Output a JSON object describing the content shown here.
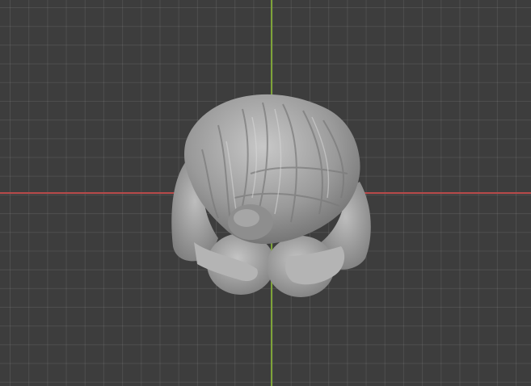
{
  "viewport": {
    "background_color": "#3d3d3d",
    "grid_color": "#4a4a4a",
    "axis_x_color": "#b84a4a",
    "axis_y_color": "#7ea338"
  },
  "model": {
    "icon": "sculpt-mesh-icon",
    "color": "#a8a8a8"
  }
}
